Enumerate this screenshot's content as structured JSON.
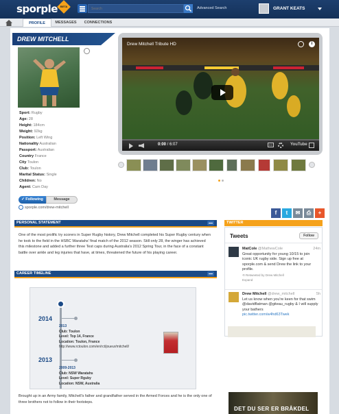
{
  "app": {
    "logo_text": "sporple",
    "logo_badge": "BETA",
    "search_placeholder": "Search",
    "advanced_search": "Advanced Search",
    "user_name": "GRANT KEATS"
  },
  "nav": {
    "tabs": [
      {
        "label": "PROFILE",
        "active": true
      },
      {
        "label": "MESSAGES",
        "active": false
      },
      {
        "label": "CONNECTIONS",
        "active": false
      }
    ]
  },
  "profile": {
    "name": "DREW MITCHELL",
    "fields": [
      {
        "label": "Sport:",
        "value": "Rugby"
      },
      {
        "label": "Age:",
        "value": "28"
      },
      {
        "label": "Height:",
        "value": "184cm"
      },
      {
        "label": "Weight:",
        "value": "92kg"
      },
      {
        "label": "Position:",
        "value": "Left Wing"
      },
      {
        "label": "Nationality",
        "value": "Australian"
      },
      {
        "label": "Passport:",
        "value": "Australian"
      },
      {
        "label": "Country",
        "value": "France"
      },
      {
        "label": "City",
        "value": "Toulon"
      },
      {
        "label": "Club:",
        "value": "Toulon"
      },
      {
        "label": "Marital Status:",
        "value": "Single"
      },
      {
        "label": "Children:",
        "value": "No"
      },
      {
        "label": "Agent:",
        "value": "Cam Day"
      }
    ],
    "follow_label": "Following",
    "message_label": "Message",
    "url": "sporple.com/drew-mitchell"
  },
  "video": {
    "title": "Drew Mitchell Tribute HD",
    "time_current": "0:00",
    "time_total": "6:07",
    "youtube": "YouTube",
    "cc": "CC",
    "info_glyph": "i"
  },
  "share": {
    "icons": [
      {
        "name": "facebook-icon",
        "glyph": "f",
        "color": "#3b5998"
      },
      {
        "name": "twitter-share-icon",
        "glyph": "t",
        "color": "#2aa9e0"
      },
      {
        "name": "email-icon",
        "glyph": "✉",
        "color": "#7a8a99"
      },
      {
        "name": "print-icon",
        "glyph": "⎙",
        "color": "#7a8a99"
      },
      {
        "name": "plus-icon",
        "glyph": "+",
        "color": "#e8572b"
      }
    ]
  },
  "personal_statement": {
    "heading": "PERSONAL STATEMENT",
    "text": "One of the most prolific try scorers in Super Rugby history, Drew Mitchell completed his Super Rugby century when he took to the field in the HSBC Waratahs' final match of the 2012 season. Still only 28, the winger has achieved this milestone and added a further three Test caps during Australia's 2012 Spring Tour, in the face of a constant battle over ankle and leg injuries that have, at times, threatened the future of his playing career."
  },
  "timeline": {
    "heading": "CAREER TIMELINE",
    "years": [
      "2014",
      "2013"
    ],
    "entries": [
      {
        "period": "2013",
        "club": "Club: Toulon",
        "level": "Level: Top 14, France",
        "location": "Location: Toulon, France",
        "url": "http://www.rctoulon.com/en/rct/joueur/mitchell/"
      },
      {
        "period": "2009-2013",
        "club": "Club: NSW Waratahs",
        "level": "Level: Super Rguby",
        "location": "Location: NSW, Australia",
        "url": ""
      }
    ]
  },
  "bio_end": "Brought up in an Army family, Mitchell's father and grandfather served in the Armed Forces and he is the only one of three brothers not to follow in their footsteps.",
  "twitter": {
    "heading": "TWITTER",
    "title": "Tweets",
    "follow_label": "Follow",
    "tweets": [
      {
        "name": "MatCole",
        "handle": "@MathewCole",
        "time": "24m",
        "text": "Great opportunity for young 10/15 to join iconic UK rugby side. Sign up free at sporple.com & send Drew the link to your profile.",
        "meta": "Retweeted by Drew Mitchell",
        "expand": "Expand"
      },
      {
        "name": "Drew Mitchell",
        "handle": "@drew_mitchell",
        "time": "5h",
        "text": "Let us know when you're keen for that swim @davidflatman @giteau_rugby & I will supply your bathers",
        "link": "pic.twitter.com/w4hd63Twek"
      }
    ]
  },
  "ad": {
    "text": "DET DU SER ER BRÅKDEL"
  },
  "colors": {
    "brand_navy": "#1b4a86",
    "accent_orange": "#f5a21b",
    "link_blue": "#2a77c2"
  }
}
